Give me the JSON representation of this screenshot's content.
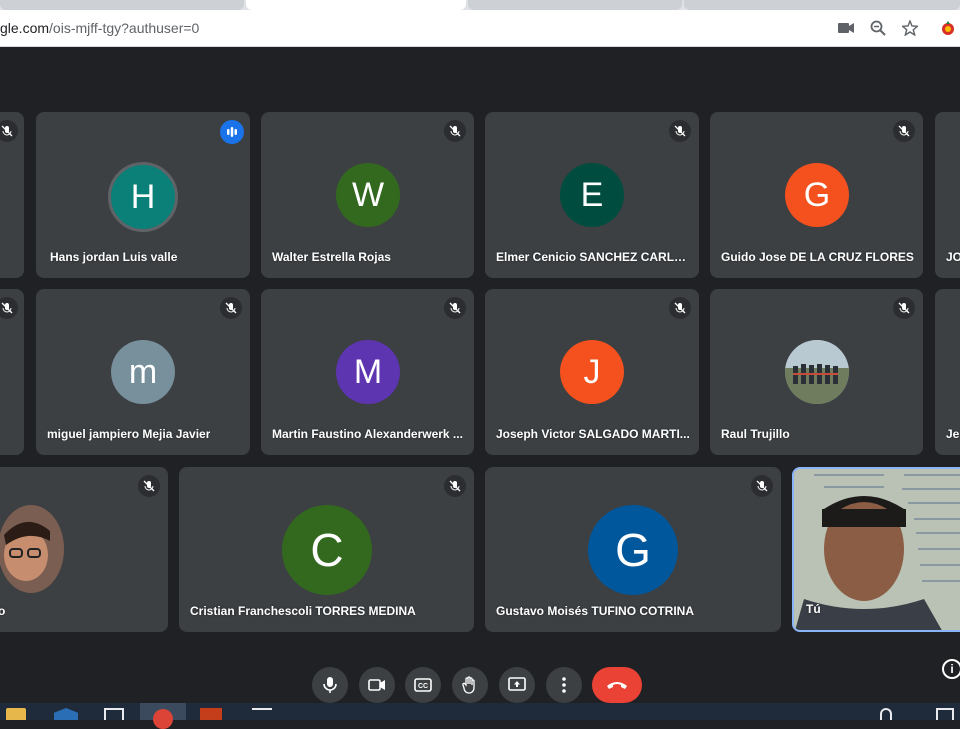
{
  "browser": {
    "url_host": "gle.com",
    "url_path": "/ois-mjff-tgy?authuser=0"
  },
  "meeting": {
    "participants": [
      {
        "name": "Hans jordan Luis valle",
        "initial": "H",
        "avatar_color": "#0b8078",
        "speaking": true
      },
      {
        "name": "Walter Estrella Rojas",
        "initial": "W",
        "avatar_color": "#33691e",
        "speaking": false
      },
      {
        "name": "Elmer Cenicio SANCHEZ CARLOS",
        "initial": "E",
        "avatar_color": "#004d40",
        "speaking": false
      },
      {
        "name": "Guido Jose DE LA CRUZ FLORES",
        "initial": "G",
        "avatar_color": "#f4511e",
        "speaking": false
      },
      {
        "name": "JO",
        "initial": "",
        "avatar_color": "#3c4043",
        "speaking": false
      },
      {
        "name": "miguel jampiero Mejia Javier",
        "initial": "m",
        "avatar_color": "#78909c",
        "speaking": false
      },
      {
        "name": "Martin Faustino Alexanderwerk ...",
        "initial": "M",
        "avatar_color": "#5e35b1",
        "speaking": false
      },
      {
        "name": "Joseph Victor SALGADO MARTI...",
        "initial": "J",
        "avatar_color": "#f4511e",
        "speaking": false
      },
      {
        "name": "Raul Trujillo",
        "initial": "",
        "avatar_color": "#6d7b86",
        "speaking": false
      },
      {
        "name": "Je",
        "initial": "",
        "avatar_color": "#3c4043",
        "speaking": false
      },
      {
        "name": "o",
        "initial": "",
        "avatar_color": "#8d6e63",
        "speaking": false
      },
      {
        "name": "Cristian Franchescoli TORRES MEDINA",
        "initial": "C",
        "avatar_color": "#33691e",
        "speaking": false
      },
      {
        "name": "Gustavo Moisés TUFINO COTRINA",
        "initial": "G",
        "avatar_color": "#01579b",
        "speaking": false
      },
      {
        "name": "Tú",
        "initial": "",
        "avatar_color": "#b0b9a8",
        "speaking": false
      }
    ]
  },
  "colors": {
    "background": "#202124",
    "tile": "#3c4043",
    "hangup": "#ea4335",
    "self_border": "#8ab4f8",
    "speaking_indicator": "#1a73e8"
  },
  "icons": {
    "muted": "mic-off-icon",
    "speaking": "audio-bars-icon",
    "controls": [
      "mic-icon",
      "camera-icon",
      "captions-icon",
      "raise-hand-icon",
      "present-icon",
      "more-vert-icon",
      "call-end-icon",
      "info-icon"
    ]
  }
}
